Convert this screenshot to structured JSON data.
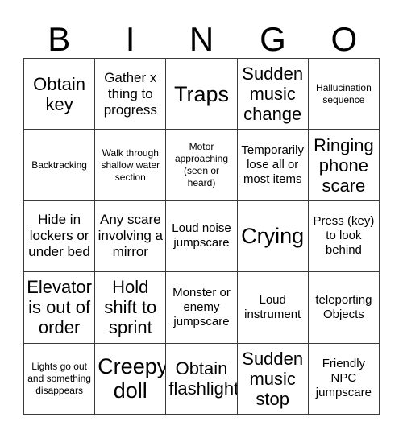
{
  "card": {
    "title": "BINGO",
    "header_letters": [
      "B",
      "I",
      "N",
      "G",
      "O"
    ],
    "border_color": "#3a3a3a",
    "background_color": "#ffffff",
    "text_color": "#000000",
    "rows": 5,
    "columns": 5,
    "cells": [
      {
        "text": "Obtain key",
        "size": "fs-lg"
      },
      {
        "text": "Gather x thing to progress",
        "size": "fs-md"
      },
      {
        "text": "Traps",
        "size": "fs-xl"
      },
      {
        "text": "Sudden music change",
        "size": "fs-lg"
      },
      {
        "text": "Hallucination sequence",
        "size": "fs-xs"
      },
      {
        "text": "Backtracking",
        "size": "fs-xs"
      },
      {
        "text": "Walk through shallow water section",
        "size": "fs-xs"
      },
      {
        "text": "Motor approaching (seen or heard)",
        "size": "fs-xs"
      },
      {
        "text": "Temporarily lose all or most items",
        "size": "fs-sm"
      },
      {
        "text": "Ringing phone scare",
        "size": "fs-lg"
      },
      {
        "text": "Hide in lockers or under bed",
        "size": "fs-md"
      },
      {
        "text": "Any scare involving a mirror",
        "size": "fs-md"
      },
      {
        "text": "Loud noise jumpscare",
        "size": "fs-sm"
      },
      {
        "text": "Crying",
        "size": "fs-xl"
      },
      {
        "text": "Press (key) to look behind",
        "size": "fs-sm"
      },
      {
        "text": "Elevator is out of order",
        "size": "fs-lg"
      },
      {
        "text": "Hold shift to sprint",
        "size": "fs-lg"
      },
      {
        "text": "Monster or enemy jumpscare",
        "size": "fs-sm"
      },
      {
        "text": "Loud instrument",
        "size": "fs-sm"
      },
      {
        "text": "teleporting Objects",
        "size": "fs-sm"
      },
      {
        "text": "Lights go out and something disappears",
        "size": "fs-xs"
      },
      {
        "text": "Creepy doll",
        "size": "fs-xl"
      },
      {
        "text": "Obtain flashlight",
        "size": "fs-lg"
      },
      {
        "text": "Sudden music stop",
        "size": "fs-lg"
      },
      {
        "text": "Friendly NPC jumpscare",
        "size": "fs-sm"
      }
    ]
  }
}
